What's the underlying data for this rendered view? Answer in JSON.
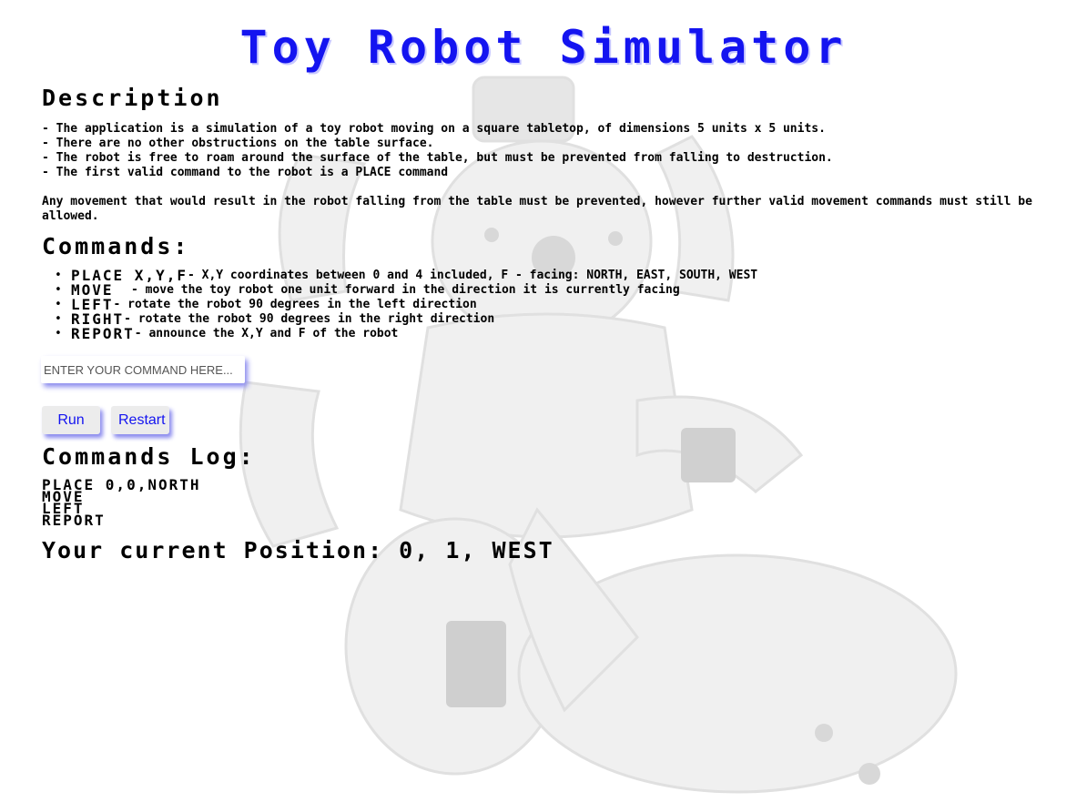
{
  "app": {
    "title": "Toy Robot Simulator"
  },
  "description": {
    "heading": "Description",
    "lines": [
      "- The application is a simulation of a toy robot moving on a square tabletop, of dimensions 5 units x 5 units.",
      "- There are no other obstructions on the table surface.",
      "- The robot is free to roam around the surface of the table, but must be prevented from falling to destruction.",
      "- The first valid command to the robot is a PLACE command"
    ],
    "paragraph": "Any movement that would result in the robot falling from the table must be prevented, however further valid movement commands must still be allowed."
  },
  "commands": {
    "heading": "Commands:",
    "items": [
      {
        "name": "PLACE X,Y,F",
        "desc": "- X,Y coordinates between 0 and 4 included, F - facing: NORTH, EAST, SOUTH, WEST"
      },
      {
        "name": "MOVE ",
        "desc": " - move the toy robot one unit forward in the direction it is currently facing"
      },
      {
        "name": "LEFT",
        "desc": "- rotate the robot 90 degrees in the left direction"
      },
      {
        "name": "RIGHT",
        "desc": "- rotate the robot 90 degrees in the right direction"
      },
      {
        "name": "REPORT",
        "desc": "- announce the X,Y and F of the robot"
      }
    ]
  },
  "input": {
    "placeholder": "ENTER YOUR COMMAND HERE...",
    "value": ""
  },
  "buttons": {
    "run_label": "Run",
    "restart_label": "Restart"
  },
  "log": {
    "heading": "Commands Log:",
    "entries": [
      "PLACE 0,0,NORTH",
      "MOVE",
      "LEFT",
      "REPORT"
    ]
  },
  "position": {
    "text": "Your current Position: 0, 1, WEST"
  },
  "colors": {
    "accent": "#1414f0",
    "button_bg": "#ececec",
    "shadow": "#8a8aee"
  },
  "icons": {
    "bullet": "disc-bullet-icon",
    "background": "robot-illustration"
  }
}
